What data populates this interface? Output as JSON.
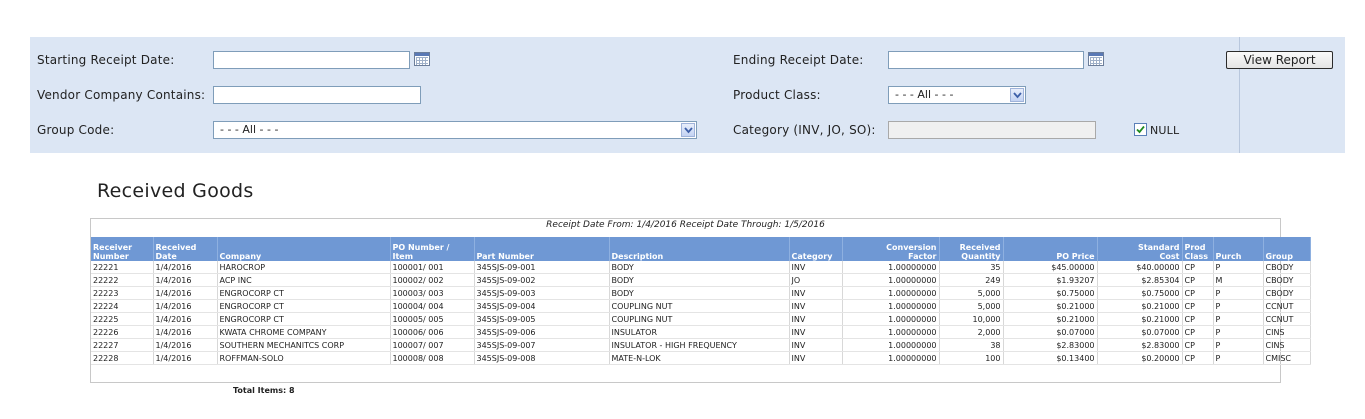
{
  "filters": {
    "starting_date_label": "Starting Receipt Date:",
    "starting_date_value": "",
    "ending_date_label": "Ending Receipt Date:",
    "ending_date_value": "",
    "vendor_label": "Vendor Company Contains:",
    "vendor_value": "",
    "product_class_label": "Product Class:",
    "product_class_value": "- - - All - - -",
    "group_code_label": "Group Code:",
    "group_code_value": "- - - All - - -",
    "category_label": "Category (INV, JO, SO):",
    "category_value": "",
    "null_label": "NULL",
    "null_checked": true,
    "view_report_label": "View Report"
  },
  "report": {
    "title": "Received Goods",
    "date_range": "Receipt Date From: 1/4/2016 Receipt Date Through: 1/5/2016",
    "columns": [
      {
        "top": "Receiver",
        "bottom": "Number"
      },
      {
        "top": "Received",
        "bottom": "Date"
      },
      {
        "top": "",
        "bottom": "Company"
      },
      {
        "top": "PO Number /",
        "bottom": "Item"
      },
      {
        "top": "",
        "bottom": "Part Number"
      },
      {
        "top": "",
        "bottom": "Description"
      },
      {
        "top": "",
        "bottom": "Category"
      },
      {
        "top": "Conversion",
        "bottom": "Factor"
      },
      {
        "top": "Received",
        "bottom": "Quantity"
      },
      {
        "top": "",
        "bottom": "PO Price"
      },
      {
        "top": "Standard",
        "bottom": "Cost"
      },
      {
        "top": "Prod",
        "bottom": "Class"
      },
      {
        "top": "",
        "bottom": "Purch"
      },
      {
        "top": "",
        "bottom": "Group"
      }
    ],
    "rows": [
      [
        "22221",
        "1/4/2016",
        "HAROCROP",
        "100001/ 001",
        "345SJS-09-001",
        "BODY",
        "INV",
        "1.00000000",
        "35",
        "$45.00000",
        "$40.00000",
        "CP",
        "P",
        "CBODY"
      ],
      [
        "22222",
        "1/4/2016",
        "ACP INC",
        "100002/ 002",
        "345SJS-09-002",
        "BODY",
        "JO",
        "1.00000000",
        "249",
        "$1.93207",
        "$2.85304",
        "CP",
        "M",
        "CBODY"
      ],
      [
        "22223",
        "1/4/2016",
        "ENGROCORP CT",
        "100003/ 003",
        "345SJS-09-003",
        "BODY",
        "INV",
        "1.00000000",
        "5,000",
        "$0.75000",
        "$0.75000",
        "CP",
        "P",
        "CBODY"
      ],
      [
        "22224",
        "1/4/2016",
        "ENGROCORP CT",
        "100004/ 004",
        "345SJS-09-004",
        "COUPLING NUT",
        "INV",
        "1.00000000",
        "5,000",
        "$0.21000",
        "$0.21000",
        "CP",
        "P",
        "CCNUT"
      ],
      [
        "22225",
        "1/4/2016",
        "ENGROCORP CT",
        "100005/ 005",
        "345SJS-09-005",
        "COUPLING NUT",
        "INV",
        "1.00000000",
        "10,000",
        "$0.21000",
        "$0.21000",
        "CP",
        "P",
        "CCNUT"
      ],
      [
        "22226",
        "1/4/2016",
        "KWATA CHROME COMPANY",
        "100006/ 006",
        "345SJS-09-006",
        "INSULATOR",
        "INV",
        "1.00000000",
        "2,000",
        "$0.07000",
        "$0.07000",
        "CP",
        "P",
        "CINS"
      ],
      [
        "22227",
        "1/4/2016",
        "SOUTHERN MECHANITCS CORP",
        "100007/ 007",
        "345SJS-09-007",
        "INSULATOR - HIGH FREQUENCY",
        "INV",
        "1.00000000",
        "38",
        "$2.83000",
        "$2.83000",
        "CP",
        "P",
        "CINS"
      ],
      [
        "22228",
        "1/4/2016",
        "ROFFMAN-SOLO",
        "100008/ 008",
        "345SJS-09-008",
        "MATE-N-LOK",
        "INV",
        "1.00000000",
        "100",
        "$0.13400",
        "$0.20000",
        "CP",
        "P",
        "CMISC"
      ]
    ],
    "total_items": "Total Items: 8"
  }
}
